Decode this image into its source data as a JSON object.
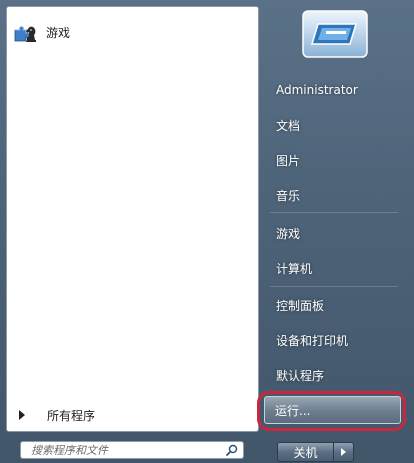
{
  "left_pane": {
    "pinned": [
      {
        "label": "游戏",
        "icon": "games-icon"
      }
    ],
    "all_programs_label": "所有程序"
  },
  "search": {
    "placeholder": "搜索程序和文件",
    "icon": "search-icon"
  },
  "right_pane": {
    "user_icon": "user-picture-icon",
    "items": [
      {
        "label": "Administrator"
      },
      {
        "label": "文档"
      },
      {
        "label": "图片"
      },
      {
        "label": "音乐"
      },
      {
        "label": "游戏"
      },
      {
        "label": "计算机"
      },
      {
        "label": "控制面板"
      },
      {
        "label": "设备和打印机"
      },
      {
        "label": "默认程序"
      }
    ],
    "run_label": "运行..."
  },
  "shutdown": {
    "label": "关机",
    "arrow_icon": "chevron-right-icon"
  },
  "colors": {
    "highlight": "#c8283e",
    "pane_background": "#4e6479"
  }
}
